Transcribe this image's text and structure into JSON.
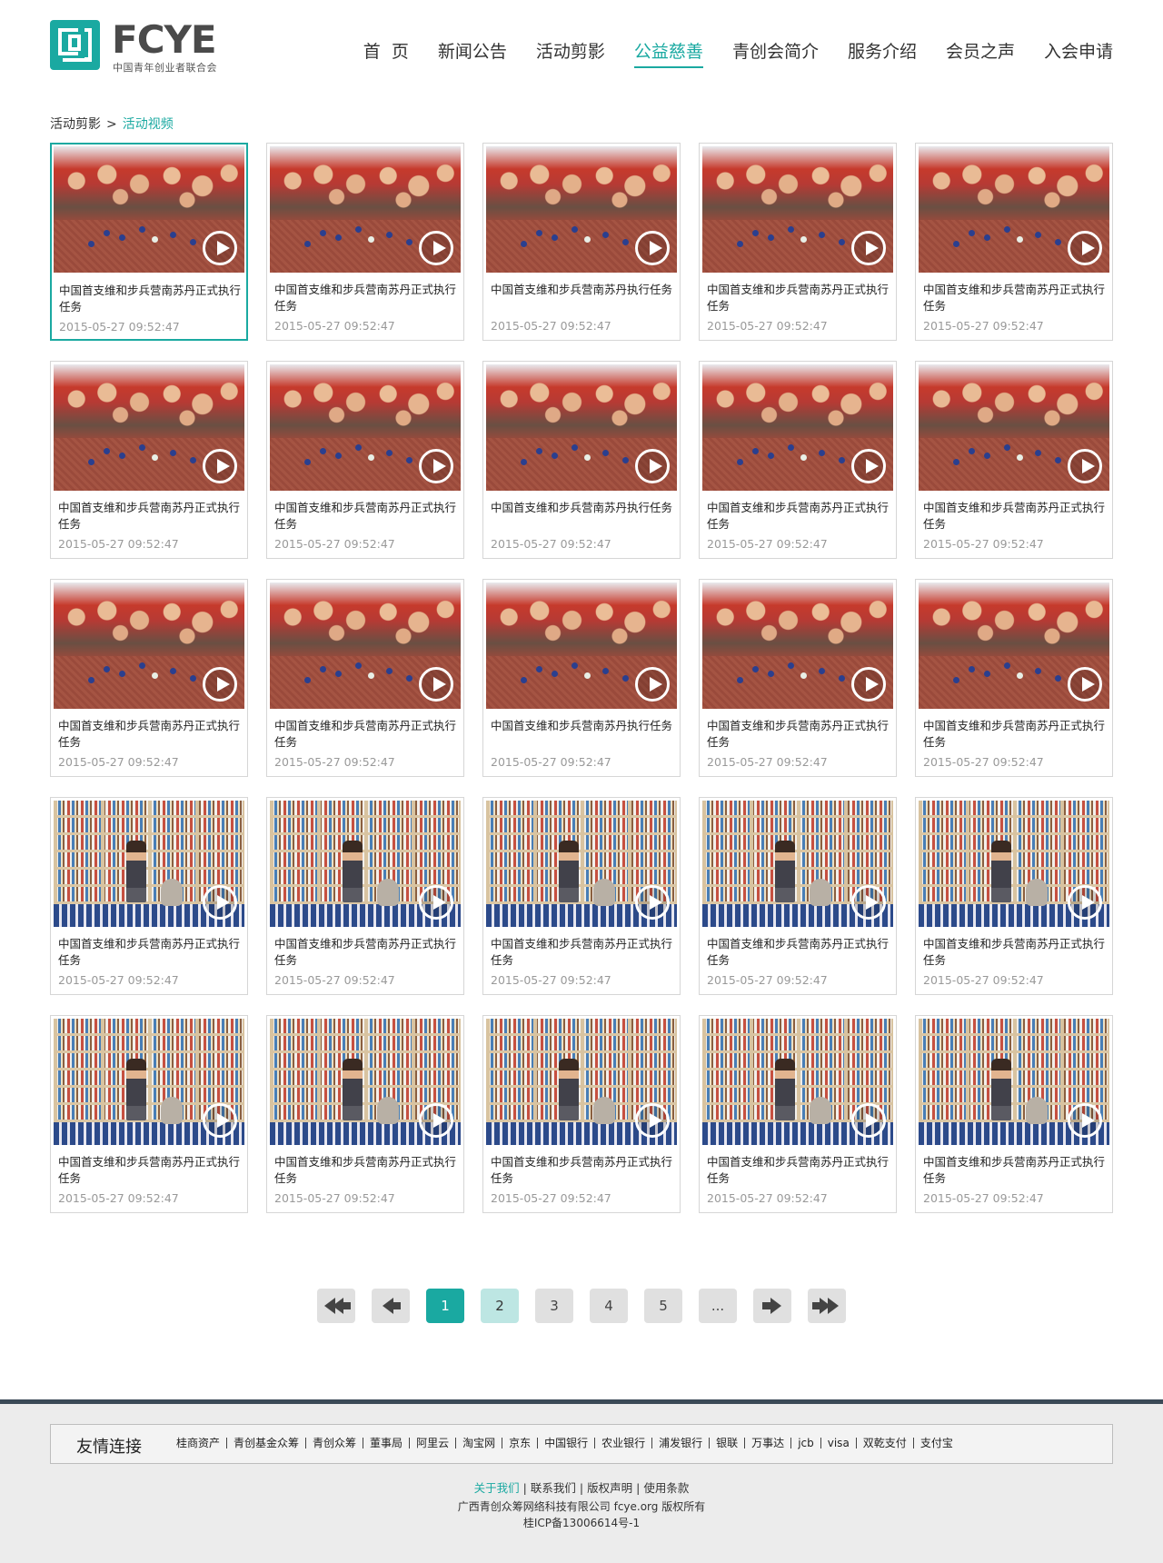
{
  "logo": {
    "brand": "FCYE",
    "subtitle": "中国青年创业者联合会"
  },
  "nav": [
    {
      "label": "首  页"
    },
    {
      "label": "新闻公告"
    },
    {
      "label": "活动剪影"
    },
    {
      "label": "公益慈善"
    },
    {
      "label": "青创会简介"
    },
    {
      "label": "服务介绍"
    },
    {
      "label": "会员之声"
    },
    {
      "label": "入会申请"
    }
  ],
  "breadcrumb": {
    "parent": "活动剪影",
    "separator": ">",
    "current": "活动视频"
  },
  "cards": {
    "title_long": "中国首支维和步兵营南苏丹正式执行任务",
    "title_short": "中国首支维和步兵营南苏丹执行任务",
    "date": "2015-05-27 09:52:47"
  },
  "pagination": {
    "pages": [
      "1",
      "2",
      "3",
      "4",
      "5",
      "..."
    ],
    "current": "1"
  },
  "footer": {
    "links_title": "友情连接",
    "links": [
      "桂商资产",
      "青创基金众筹",
      "青创众筹",
      "董事局",
      "阿里云",
      "淘宝网",
      "京东",
      "中国银行",
      "农业银行",
      "浦发银行",
      "银联",
      "万事达",
      "jcb",
      "visa",
      "双乾支付",
      "支付宝"
    ],
    "nav": [
      "关于我们",
      "联系我们",
      "版权声明",
      "使用条款"
    ],
    "company": "广西青创众筹网络科技有限公司 fcye.org 版权所有",
    "icp": "桂ICP备13006614号-1"
  },
  "colors": {
    "accent": "#1aa9a1",
    "footer_bar": "#3b4a57"
  }
}
